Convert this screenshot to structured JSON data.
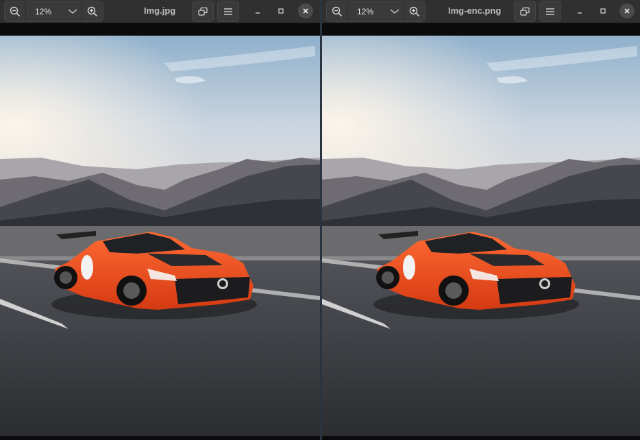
{
  "viewers": [
    {
      "title": "Img.jpg",
      "zoom": "12%",
      "icons": {
        "zoom_out": "zoom-out-icon",
        "zoom_menu": "chevron-down-icon",
        "zoom_in": "zoom-in-icon",
        "rotate": "rotate-icon",
        "menu": "hamburger-menu-icon",
        "minimize": "minimize-icon",
        "maximize": "maximize-icon",
        "close": "close-icon"
      }
    },
    {
      "title": "Img-enc.png",
      "zoom": "12%",
      "icons": {
        "zoom_out": "zoom-out-icon",
        "zoom_menu": "chevron-down-icon",
        "zoom_in": "zoom-in-icon",
        "rotate": "rotate-icon",
        "menu": "hamburger-menu-icon",
        "minimize": "minimize-icon",
        "maximize": "maximize-icon",
        "close": "close-icon"
      }
    }
  ],
  "colors": {
    "headerbar": "#303030",
    "button_bg": "#3a3a3a",
    "car_body": "#f04a1e",
    "sky_top": "#8fb0cc",
    "road": "#3b3d42"
  }
}
